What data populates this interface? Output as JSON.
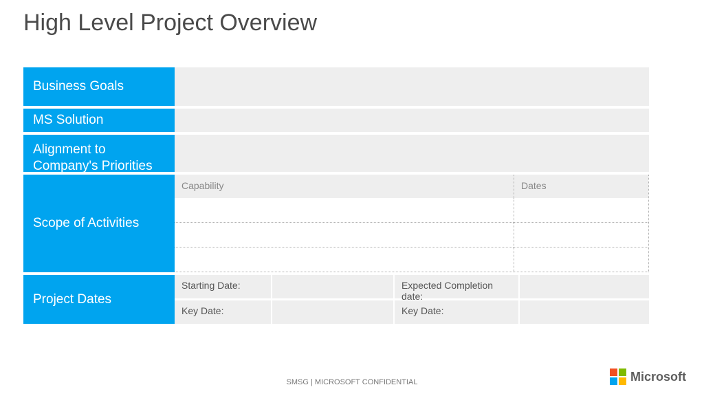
{
  "title": "High Level Project Overview",
  "rows": {
    "business_goals": {
      "label": "Business Goals",
      "value": ""
    },
    "ms_solution": {
      "label": "MS Solution",
      "value": ""
    },
    "alignment": {
      "label": "Alignment to Company's Priorities",
      "value": ""
    }
  },
  "scope": {
    "label": "Scope of Activities",
    "columns": {
      "capability": "Capability",
      "dates": "Dates"
    },
    "items": [
      {
        "capability": "",
        "dates": ""
      },
      {
        "capability": "",
        "dates": ""
      },
      {
        "capability": "",
        "dates": ""
      }
    ]
  },
  "project_dates": {
    "label": "Project Dates",
    "starting_label": "Starting Date:",
    "starting_value": "",
    "expected_label": "Expected Completion date:",
    "expected_value": "",
    "key1_label": "Key Date:",
    "key1_value": "",
    "key2_label": "Key Date:",
    "key2_value": ""
  },
  "footer": "SMSG | MICROSOFT CONFIDENTIAL",
  "brand": "Microsoft"
}
